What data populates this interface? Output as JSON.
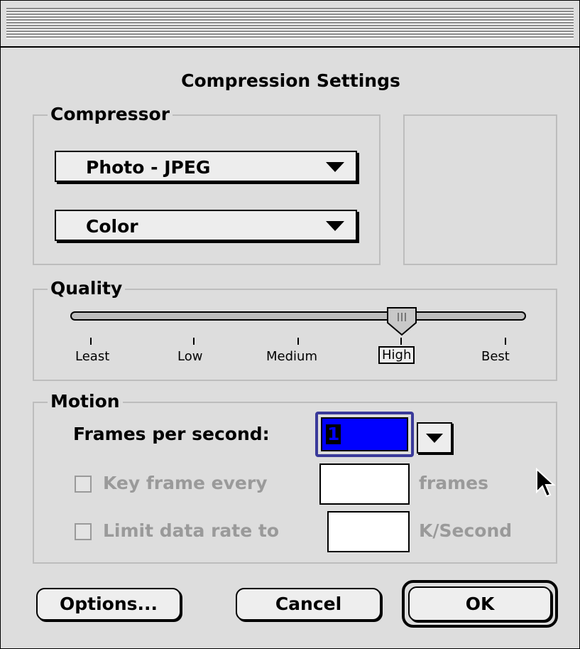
{
  "window": {
    "title": "Compression Settings"
  },
  "compressor": {
    "legend": "Compressor",
    "codec": "Photo - JPEG",
    "depth": "Color"
  },
  "quality": {
    "legend": "Quality",
    "level": 0.71,
    "ticks": [
      "Least",
      "Low",
      "Medium",
      "High",
      "Best"
    ],
    "selected": "High"
  },
  "motion": {
    "legend": "Motion",
    "fps_label": "Frames per second:",
    "fps_value": "1",
    "keyframe_label": "Key frame every",
    "keyframe_value": "",
    "keyframe_unit": "frames",
    "datarate_label": "Limit data rate to",
    "datarate_value": "",
    "datarate_unit": "K/Second"
  },
  "buttons": {
    "options": "Options...",
    "cancel": "Cancel",
    "ok": "OK"
  }
}
